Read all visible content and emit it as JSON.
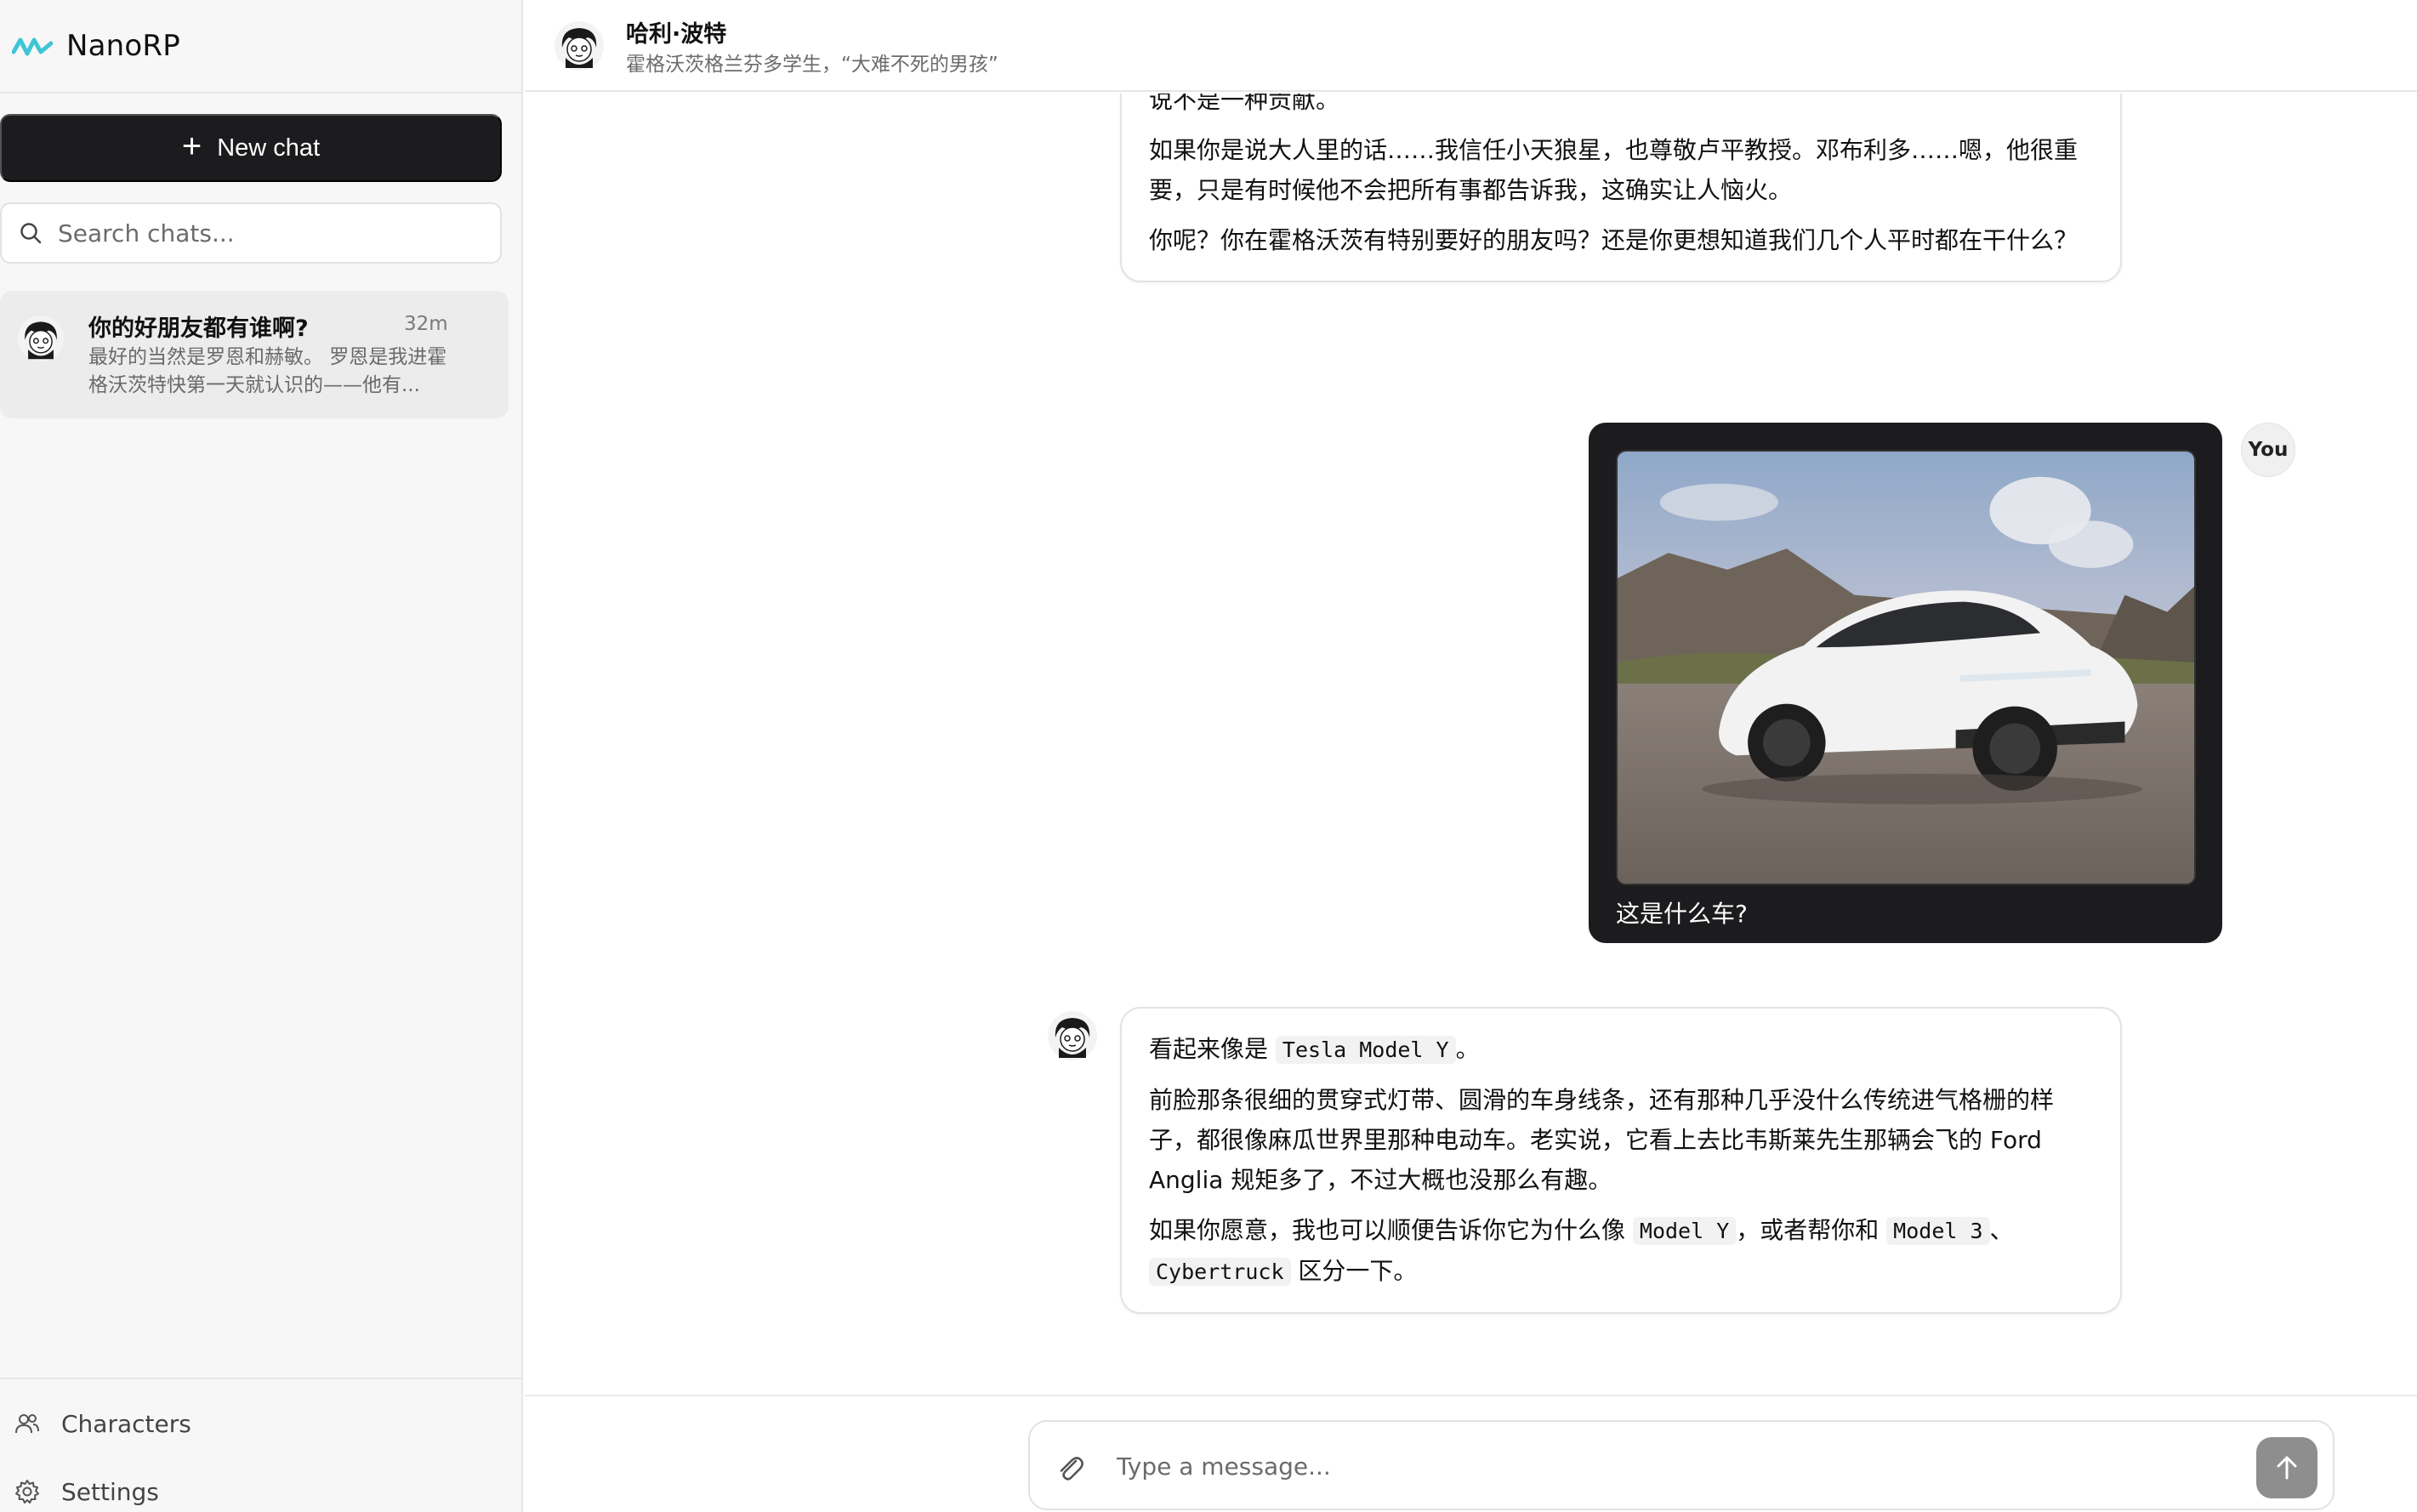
{
  "app": {
    "name": "NanoRP"
  },
  "sidebar": {
    "new_chat_label": "New chat",
    "search_placeholder": "Search chats...",
    "chats": [
      {
        "title": "你的好朋友都有谁啊?",
        "time": "32m",
        "preview": "最好的当然是罗恩和赫敏。 罗恩是我进霍格沃茨特快第一天就认识的——他有..."
      }
    ],
    "nav": {
      "characters": "Characters",
      "settings": "Settings"
    }
  },
  "header": {
    "character_name": "哈利·波特",
    "character_desc": "霍格沃茨格兰芬多学生，“大难不死的男孩”"
  },
  "messages": {
    "m1": {
      "p0": "要说别的朋友，金妮、纳威、卢娜我也很信任。还有双胞胎——弗雷德和乔治——他们总能把学校里最糟糕的一天搅得没那么糟，当然，也经常顺便把费尔奇气个半死，这点很难说不是一种贡献。",
      "p1": "如果你是说大人里的话……我信任小天狼星，也尊敬卢平教授。邓布利多……嗯，他很重要，只是有时候他不会把所有事都告诉我，这确实让人恼火。",
      "p2": "你呢？你在霍格沃茨有特别要好的朋友吗？还是你更想知道我们几个人平时都在干什么？"
    },
    "m2": {
      "sender": "You",
      "caption": "这是什么车?"
    },
    "m3": {
      "p1_pre": "看起来像是 ",
      "p1_code": "Tesla Model Y",
      "p1_post": "。",
      "p2": "前脸那条很细的贯穿式灯带、圆滑的车身线条，还有那种几乎没什么传统进气格栅的样子，都很像麻瓜世界里那种电动车。老实说，它看上去比韦斯莱先生那辆会飞的 Ford Anglia 规矩多了，不过大概也没那么有趣。",
      "p3_a": "如果你愿意，我也可以顺便告诉你它为什么像 ",
      "p3_code1": "Model Y",
      "p3_b": "，或者帮你和 ",
      "p3_code2": "Model 3",
      "p3_c": "、",
      "p3_code3": "Cybertruck",
      "p3_d": " 区分一下。"
    }
  },
  "composer": {
    "placeholder": "Type a message..."
  },
  "icons": {
    "logo": "nanorp-logo-icon",
    "plus": "plus-icon",
    "search": "search-icon",
    "characters": "users-icon",
    "settings": "gear-icon",
    "attach": "paperclip-icon",
    "send": "arrow-up-icon"
  },
  "colors": {
    "accent": "#3fc5d6",
    "dark_button": "#1c1c1e",
    "sidebar_bg": "#f7f7f7",
    "send_button": "#8e8e8e"
  }
}
